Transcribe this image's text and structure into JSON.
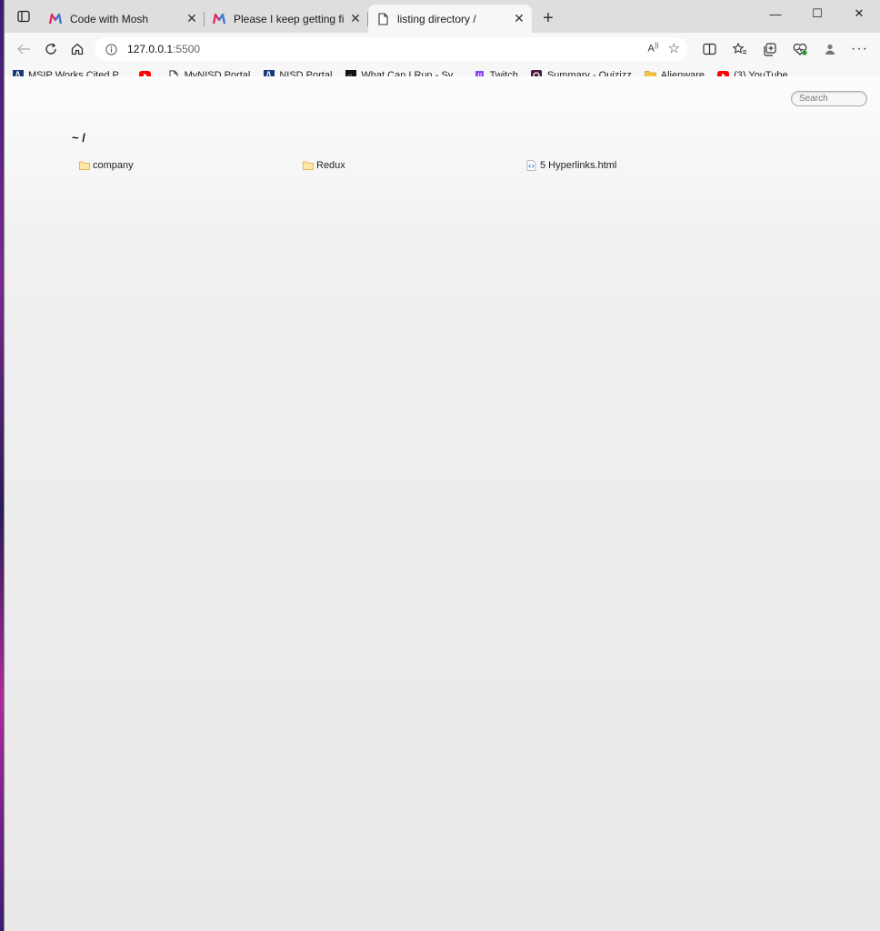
{
  "tabs": [
    {
      "title": "Code with Mosh",
      "icon": "mosh-logo-icon",
      "active": false
    },
    {
      "title": "Please I keep getting file and dir",
      "icon": "mosh-logo-icon",
      "active": false
    },
    {
      "title": "listing directory /",
      "icon": "page-icon",
      "active": true
    }
  ],
  "address": {
    "host": "127.0.0.1",
    "port": ":5500"
  },
  "bookmarks": [
    {
      "label": "MSIP Works Cited P...",
      "icon": "nisd-icon"
    },
    {
      "label": "",
      "icon": "youtube-icon"
    },
    {
      "label": "MyNISD Portal",
      "icon": "page-icon"
    },
    {
      "label": "NISD Portal",
      "icon": "nisd-icon"
    },
    {
      "label": "What Can I Run - Sy...",
      "icon": "dark-site-icon"
    },
    {
      "label": "Twitch",
      "icon": "twitch-icon"
    },
    {
      "label": "Summary - Quizizz",
      "icon": "quizizz-icon"
    },
    {
      "label": "Alienware",
      "icon": "folder-icon"
    },
    {
      "label": "(3) YouTube",
      "icon": "youtube-icon"
    }
  ],
  "page": {
    "search_placeholder": "Search",
    "breadcrumb": "~ /",
    "files": [
      {
        "name": "company",
        "type": "folder"
      },
      {
        "name": "Redux",
        "type": "folder"
      },
      {
        "name": "5 Hyperlinks.html",
        "type": "html"
      }
    ]
  },
  "colors": {
    "youtube": "#ff0000",
    "twitch": "#9146ff",
    "folder": "#f5c542"
  }
}
